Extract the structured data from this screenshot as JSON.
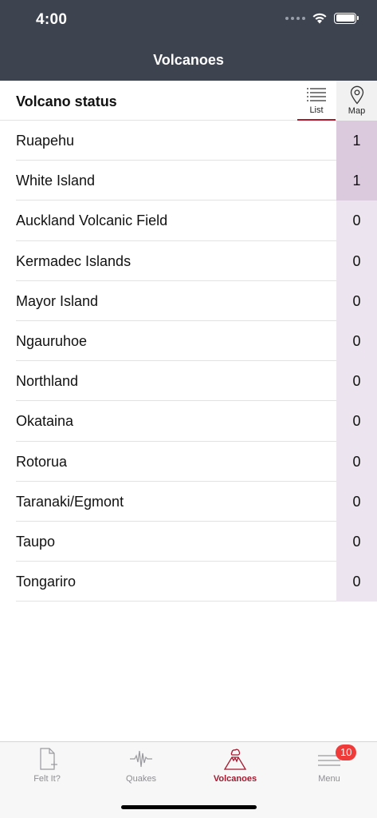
{
  "status_bar": {
    "time": "4:00"
  },
  "nav": {
    "title": "Volcanoes"
  },
  "section": {
    "title": "Volcano status",
    "list_label": "List",
    "map_label": "Map",
    "selected_view": "List"
  },
  "volcanoes": [
    {
      "name": "Ruapehu",
      "level": "1"
    },
    {
      "name": "White Island",
      "level": "1"
    },
    {
      "name": "Auckland Volcanic Field",
      "level": "0"
    },
    {
      "name": "Kermadec Islands",
      "level": "0"
    },
    {
      "name": "Mayor Island",
      "level": "0"
    },
    {
      "name": "Ngauruhoe",
      "level": "0"
    },
    {
      "name": "Northland",
      "level": "0"
    },
    {
      "name": "Okataina",
      "level": "0"
    },
    {
      "name": "Rotorua",
      "level": "0"
    },
    {
      "name": "Taranaki/Egmont",
      "level": "0"
    },
    {
      "name": "Taupo",
      "level": "0"
    },
    {
      "name": "Tongariro",
      "level": "0"
    }
  ],
  "tabs": [
    {
      "label": "Felt It?",
      "icon": "felt-it-icon",
      "active": false
    },
    {
      "label": "Quakes",
      "icon": "seismograph-icon",
      "active": false
    },
    {
      "label": "Volcanoes",
      "icon": "volcano-icon",
      "active": true
    },
    {
      "label": "Menu",
      "icon": "menu-icon",
      "active": false,
      "badge": "10"
    }
  ],
  "colors": {
    "header_bg": "#3e4350",
    "accent": "#a3192f",
    "level_raised_bg": "#dbc9de",
    "level_normal_bg": "#ece4ef",
    "badge": "#f03b3b"
  }
}
